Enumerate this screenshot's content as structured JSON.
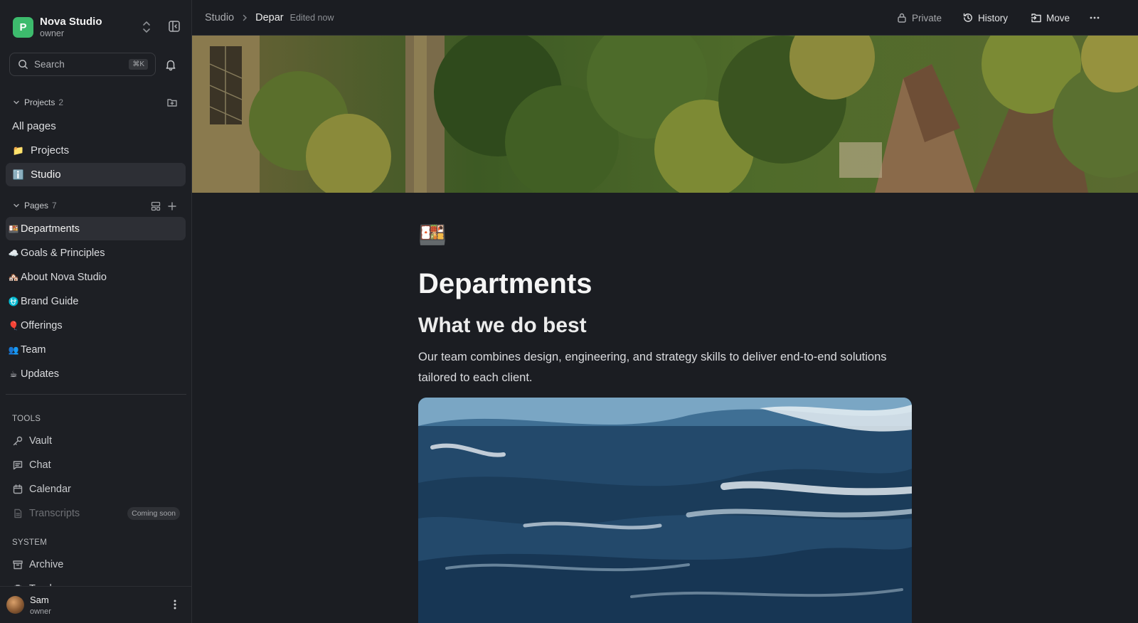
{
  "workspace": {
    "logo_letter": "P",
    "name": "Nova Studio",
    "role": "owner"
  },
  "search": {
    "placeholder": "Search",
    "shortcut": "⌘K"
  },
  "projects": {
    "title": "Projects",
    "count": "2",
    "items": [
      {
        "label": "All pages",
        "emoji": ""
      },
      {
        "label": "Projects",
        "emoji": "📁"
      },
      {
        "label": "Studio",
        "emoji": "ℹ️"
      }
    ]
  },
  "pages": {
    "title": "Pages",
    "count": "7",
    "items": [
      {
        "label": "Departments",
        "emoji": "🍱"
      },
      {
        "label": "Goals & Principles",
        "emoji": "☁️"
      },
      {
        "label": "About Nova Studio",
        "emoji": "🏘️"
      },
      {
        "label": "Brand Guide",
        "emoji": "⛎"
      },
      {
        "label": "Offerings",
        "emoji": "🎈"
      },
      {
        "label": "Team",
        "emoji": "👥"
      },
      {
        "label": "Updates",
        "emoji": "☕"
      }
    ]
  },
  "tools": {
    "title": "TOOLS",
    "items": [
      {
        "label": "Vault",
        "icon": "key-icon"
      },
      {
        "label": "Chat",
        "icon": "chat-icon"
      },
      {
        "label": "Calendar",
        "icon": "calendar-icon"
      },
      {
        "label": "Transcripts",
        "icon": "transcript-icon",
        "badge": "Coming soon"
      }
    ]
  },
  "system": {
    "title": "SYSTEM",
    "items": [
      {
        "label": "Archive",
        "icon": "archive-icon"
      },
      {
        "label": "Trash",
        "icon": "trash-icon"
      }
    ]
  },
  "user": {
    "name": "Sam",
    "role": "owner"
  },
  "breadcrumb": {
    "root": "Studio",
    "current": "Depar",
    "status": "Edited now"
  },
  "toolbar": {
    "private": "Private",
    "history": "History",
    "move": "Move"
  },
  "page": {
    "icon": "🍱",
    "title": "Departments",
    "subtitle": "What we do best",
    "body": "Our team combines design, engineering, and strategy skills to deliver end-to-end solutions tailored to each client."
  },
  "colors": {
    "accent": "#3dbb6d",
    "sidebar_bg": "#1d1f24",
    "main_bg": "#1b1d22",
    "active_item": "#2d2f35"
  }
}
